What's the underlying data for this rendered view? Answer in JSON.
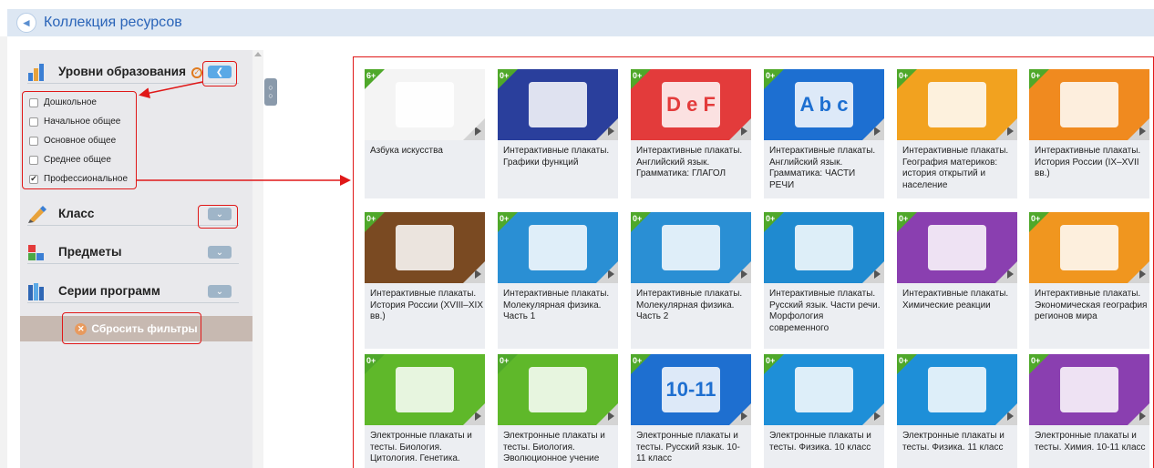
{
  "header": {
    "title": "Коллекция ресурсов"
  },
  "sidebar": {
    "sections": [
      {
        "title": "Уровни образования",
        "expanded": true,
        "color": "#3b7fd4"
      },
      {
        "title": "Класс",
        "expanded": false,
        "color": "#e8a23a"
      },
      {
        "title": "Предметы",
        "expanded": false,
        "color": "#4aa844"
      },
      {
        "title": "Серии программ",
        "expanded": false,
        "color": "#2f67b5"
      }
    ],
    "levels": [
      {
        "label": "Дошкольное",
        "checked": false
      },
      {
        "label": "Начальное общее",
        "checked": false
      },
      {
        "label": "Основное общее",
        "checked": false
      },
      {
        "label": "Среднее общее",
        "checked": false
      },
      {
        "label": "Профессиональное",
        "checked": true
      }
    ],
    "reset_label": "Сбросить фильтры"
  },
  "cards": [
    {
      "age": "6+",
      "age_color": "#4fa82a",
      "bg": "#f4f4f4",
      "title": "Азбука искусства"
    },
    {
      "age": "0+",
      "age_color": "#4fa82a",
      "bg": "#2a3f9c",
      "title": "Интерактивные плакаты. Графики функций"
    },
    {
      "age": "0+",
      "age_color": "#4fa82a",
      "bg": "#e33b3b",
      "title": "Интерактивные плакаты. Английский язык. Грамматика: ГЛАГОЛ"
    },
    {
      "age": "0+",
      "age_color": "#4fa82a",
      "bg": "#1d6fd1",
      "title": "Интерактивные плакаты. Английский язык. Грамматика: ЧАСТИ РЕЧИ"
    },
    {
      "age": "0+",
      "age_color": "#4fa82a",
      "bg": "#f2a21f",
      "title": "Интерактивные плакаты. География материков: история открытий и население"
    },
    {
      "age": "0+",
      "age_color": "#4fa82a",
      "bg": "#f08a1f",
      "title": "Интерактивные плакаты. История России (IX–XVII вв.)"
    },
    {
      "age": "0+",
      "age_color": "#4fa82a",
      "bg": "#7a4a22",
      "title": "Интерактивные плакаты. История России (XVIII–XIX вв.)"
    },
    {
      "age": "0+",
      "age_color": "#4fa82a",
      "bg": "#2a8fd4",
      "title": "Интерактивные плакаты. Молекулярная физика. Часть 1"
    },
    {
      "age": "0+",
      "age_color": "#4fa82a",
      "bg": "#2a8fd4",
      "title": "Интерактивные плакаты. Молекулярная физика. Часть 2"
    },
    {
      "age": "0+",
      "age_color": "#4fa82a",
      "bg": "#1f8ad0",
      "title": "Интерактивные плакаты. Русский язык. Части речи. Морфология современного"
    },
    {
      "age": "0+",
      "age_color": "#4fa82a",
      "bg": "#8a3fb0",
      "title": "Интерактивные плакаты. Химические реакции"
    },
    {
      "age": "0+",
      "age_color": "#4fa82a",
      "bg": "#f0961f",
      "title": "Интерактивные плакаты. Экономическая география регионов мира"
    },
    {
      "age": "0+",
      "age_color": "#4fa82a",
      "bg": "#5fb82a",
      "title": "Электронные плакаты и тесты. Биология. Цитология. Генетика."
    },
    {
      "age": "0+",
      "age_color": "#4fa82a",
      "bg": "#5fb82a",
      "title": "Электронные плакаты и тесты. Биология. Эволюционное учение"
    },
    {
      "age": "0+",
      "age_color": "#4fa82a",
      "bg": "#1e6fd0",
      "title": "Электронные плакаты и тесты. Русский язык. 10-11 класс"
    },
    {
      "age": "0+",
      "age_color": "#4fa82a",
      "bg": "#1e8fd8",
      "title": "Электронные плакаты и тесты. Физика. 10 класс"
    },
    {
      "age": "0+",
      "age_color": "#4fa82a",
      "bg": "#1e8fd8",
      "title": "Электронные плакаты и тесты. Физика. 11 класс"
    },
    {
      "age": "0+",
      "age_color": "#4fa82a",
      "bg": "#8a3fb0",
      "title": "Электронные плакаты и тесты. Химия. 10-11 класс"
    }
  ],
  "thumb_text": {
    "card2": "D e F",
    "card3": "A b c",
    "card14": "10-11"
  }
}
